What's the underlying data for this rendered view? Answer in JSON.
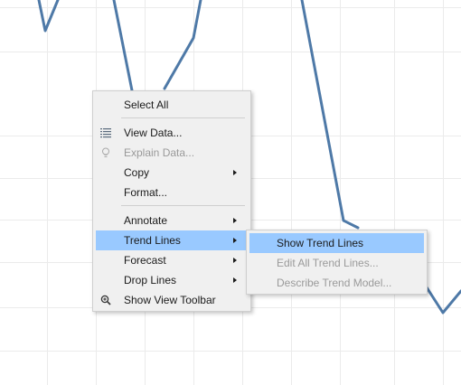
{
  "context_menu": {
    "items": [
      {
        "label": "Select All",
        "enabled": true
      },
      {
        "label": "View Data...",
        "enabled": true,
        "icon": "view-data-icon"
      },
      {
        "label": "Explain Data...",
        "enabled": false,
        "icon": "lightbulb-icon"
      },
      {
        "label": "Copy",
        "enabled": true,
        "submenu": true
      },
      {
        "label": "Format...",
        "enabled": true
      },
      {
        "label": "Annotate",
        "enabled": true,
        "submenu": true
      },
      {
        "label": "Trend Lines",
        "enabled": true,
        "submenu": true,
        "highlighted": true
      },
      {
        "label": "Forecast",
        "enabled": true,
        "submenu": true
      },
      {
        "label": "Drop Lines",
        "enabled": true,
        "submenu": true
      },
      {
        "label": "Show View Toolbar",
        "enabled": true,
        "icon": "zoom-icon"
      }
    ]
  },
  "trend_lines_submenu": {
    "items": [
      {
        "label": "Show Trend Lines",
        "enabled": true,
        "highlighted": true
      },
      {
        "label": "Edit All Trend Lines...",
        "enabled": false
      },
      {
        "label": "Describe Trend Model...",
        "enabled": false
      }
    ]
  },
  "colors": {
    "line": "#4e79a7",
    "grid": "#ebebeb",
    "menu_bg": "#f0f0f0",
    "highlight": "#99c9ff",
    "disabled_text": "#9a9a9a"
  }
}
